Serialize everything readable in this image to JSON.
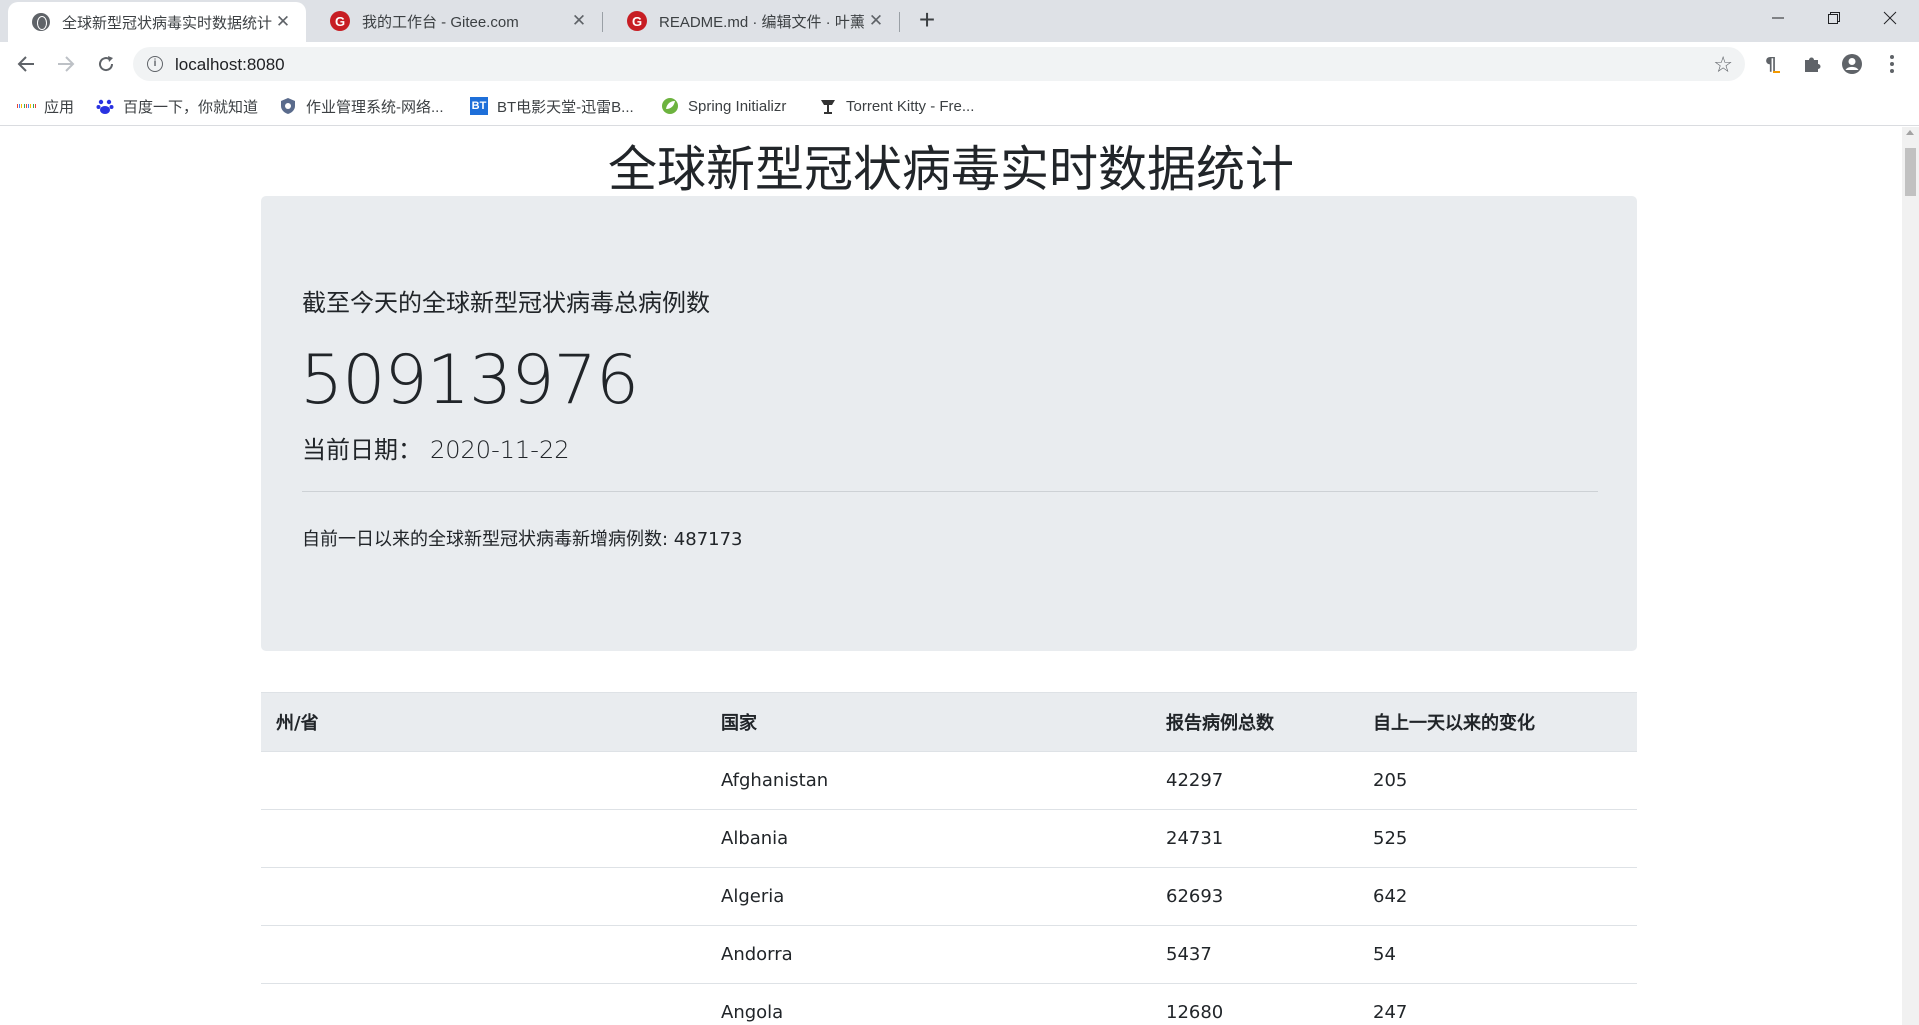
{
  "browser": {
    "tabs": [
      {
        "title": "全球新型冠状病毒实时数据统计",
        "icon": "globe-icon",
        "active": true
      },
      {
        "title": "我的工作台 - Gitee.com",
        "icon": "gitee-icon",
        "active": false
      },
      {
        "title": "README.md · 编辑文件 · 叶薰",
        "icon": "gitee-icon",
        "active": false
      }
    ],
    "address": "localhost:8080",
    "bookmarks": [
      {
        "label": "应用",
        "icon": "apps-grid-icon"
      },
      {
        "label": "百度一下，你就知道",
        "icon": "baidu-paw-icon"
      },
      {
        "label": "作业管理系统-网络...",
        "icon": "shield-icon"
      },
      {
        "label": "BT电影天堂-迅雷B...",
        "icon": "bt-icon",
        "icon_text": "BT"
      },
      {
        "label": "Spring Initializr",
        "icon": "spring-leaf-icon"
      },
      {
        "label": "Torrent Kitty - Fre...",
        "icon": "torrent-kitty-icon"
      }
    ],
    "colors": {
      "tabstrip": "#dee1e6",
      "gitee": "#c71d23",
      "bt": "#1e6fd9",
      "spring": "#6db33f"
    }
  },
  "page": {
    "title": "全球新型冠状病毒实时数据统计",
    "summary": {
      "lead": "截至今天的全球新型冠状病毒总病例数",
      "total_cases": "50913976",
      "date_label": "当前日期：",
      "date_value": "2020-11-22",
      "delta_text": "自前一日以来的全球新型冠状病毒新增病例数: 487173"
    },
    "table": {
      "headers": [
        "州/省",
        "国家",
        "报告病例总数",
        "自上一天以来的变化"
      ],
      "rows": [
        {
          "state": "",
          "country": "Afghanistan",
          "total": "42297",
          "change": "205"
        },
        {
          "state": "",
          "country": "Albania",
          "total": "24731",
          "change": "525"
        },
        {
          "state": "",
          "country": "Algeria",
          "total": "62693",
          "change": "642"
        },
        {
          "state": "",
          "country": "Andorra",
          "total": "5437",
          "change": "54"
        },
        {
          "state": "",
          "country": "Angola",
          "total": "12680",
          "change": "247"
        }
      ]
    }
  }
}
